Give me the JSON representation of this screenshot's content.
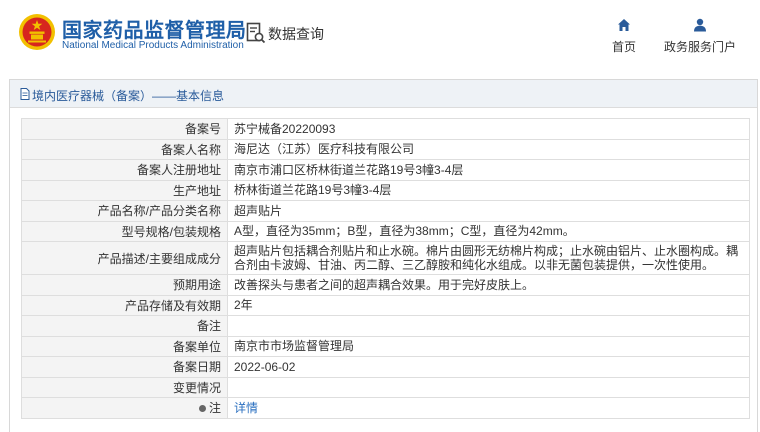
{
  "header": {
    "brand_cn": "国家药品监督管理局",
    "brand_en": "National Medical Products Administration",
    "query_label": "数据查询",
    "nav": {
      "home": "首页",
      "service": "政务服务门户"
    }
  },
  "panel": {
    "breadcrumb": "境内医疗器械（备案）——基本信息"
  },
  "record": {
    "rows": [
      {
        "label": "备案号",
        "value": "苏宁械备20220093"
      },
      {
        "label": "备案人名称",
        "value": "海尼达（江苏）医疗科技有限公司"
      },
      {
        "label": "备案人注册地址",
        "value": "南京市浦口区桥林街道兰花路19号3幢3-4层"
      },
      {
        "label": "生产地址",
        "value": "桥林街道兰花路19号3幢3-4层"
      },
      {
        "label": "产品名称/产品分类名称",
        "value": "超声贴片"
      },
      {
        "label": "型号规格/包装规格",
        "value": "A型，直径为35mm；B型，直径为38mm；C型，直径为42mm。"
      },
      {
        "label": "产品描述/主要组成成分",
        "value": "超声贴片包括耦合剂贴片和止水碗。棉片由圆形无纺棉片构成；止水碗由铝片、止水圈构成。耦合剂由卡波姆、甘油、丙二醇、三乙醇胺和纯化水组成。以非无菌包装提供，一次性使用。"
      },
      {
        "label": "预期用途",
        "value": "改善探头与患者之间的超声耦合效果。用于完好皮肤上。"
      },
      {
        "label": "产品存储及有效期",
        "value": "2年"
      },
      {
        "label": "备注",
        "value": ""
      },
      {
        "label": "备案单位",
        "value": "南京市市场监督管理局"
      },
      {
        "label": "备案日期",
        "value": "2022-06-02"
      },
      {
        "label": "变更情况",
        "value": ""
      },
      {
        "label": "注",
        "value": "详情"
      }
    ]
  },
  "colors": {
    "brand_blue": "#1f5fa8",
    "link_blue": "#2a6fc0",
    "emblem_red": "#d7261e",
    "emblem_gold": "#f2c000"
  },
  "icons": {
    "emblem": "national-emblem-icon",
    "query": "document-search-icon",
    "home": "home-icon",
    "service": "user-icon",
    "breadcrumb": "document-icon",
    "note": "pin-icon"
  }
}
